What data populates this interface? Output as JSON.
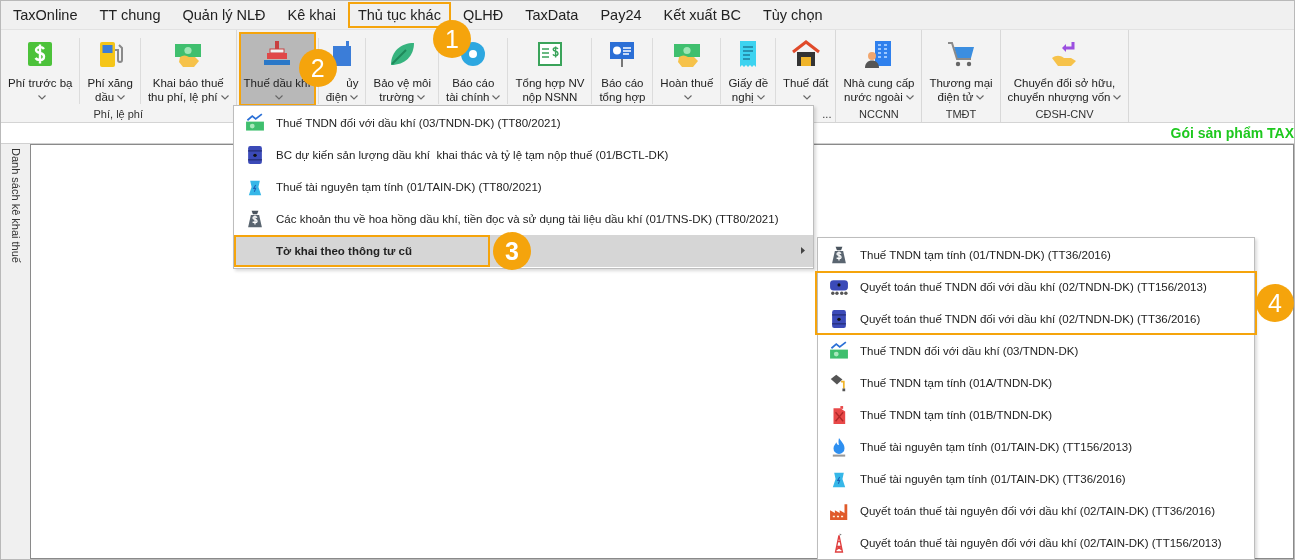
{
  "tabs": [
    {
      "label": "TaxOnline"
    },
    {
      "label": "TT chung"
    },
    {
      "label": "Quản lý NLĐ"
    },
    {
      "label": "Kê khai"
    },
    {
      "label": "Thủ tục khác",
      "callout": "1"
    },
    {
      "label": "QLHĐ"
    },
    {
      "label": "TaxData"
    },
    {
      "label": "Pay24"
    },
    {
      "label": "Kết xuất BC"
    },
    {
      "label": "Tùy chọn"
    }
  ],
  "ribbon": {
    "groups": [
      {
        "label": "Phí, lệ phí",
        "covered": false,
        "buttons": [
          {
            "lines": [
              "Phí trước bạ"
            ],
            "dropdown": true,
            "selected": false,
            "covered": false
          },
          {
            "lines": [
              "Phí xăng",
              "dầu"
            ],
            "dropdown": true,
            "selected": false,
            "covered": false
          },
          {
            "lines": [
              "Khai báo thuế",
              "thu phí, lệ phí"
            ],
            "dropdown": true,
            "selected": false,
            "covered": false
          }
        ]
      },
      {
        "label": "...",
        "covered": true,
        "buttons": [
          {
            "lines": [
              "Thuế dầu khí"
            ],
            "dropdown": true,
            "selected": true,
            "covered": false,
            "callout": "2"
          },
          {
            "lines": [
              "ủy",
              "điện"
            ],
            "dropdown": true,
            "selected": false,
            "covered": true
          },
          {
            "lines": [
              "Bảo vệ môi",
              "trường"
            ],
            "dropdown": true,
            "selected": false,
            "covered": false
          },
          {
            "lines": [
              "Báo cáo",
              "tài chính"
            ],
            "dropdown": true,
            "selected": false,
            "covered": false
          },
          {
            "lines": [
              "Tổng hợp NV",
              "nộp NSNN"
            ],
            "dropdown": false,
            "selected": false,
            "covered": false
          },
          {
            "lines": [
              "Báo cáo",
              "tổng hợp"
            ],
            "dropdown": false,
            "selected": false,
            "covered": false
          },
          {
            "lines": [
              "Hoàn thuế"
            ],
            "dropdown": true,
            "selected": false,
            "covered": false
          },
          {
            "lines": [
              "Giấy đề",
              "nghị"
            ],
            "dropdown": true,
            "selected": false,
            "covered": false
          },
          {
            "lines": [
              "Thuế đất"
            ],
            "dropdown": true,
            "selected": false,
            "covered": false
          }
        ]
      },
      {
        "label": "NCCNN",
        "covered": false,
        "buttons": [
          {
            "lines": [
              "Nhà cung cấp",
              "nước ngoài"
            ],
            "dropdown": true,
            "selected": false,
            "covered": false
          }
        ]
      },
      {
        "label": "TMĐT",
        "covered": false,
        "buttons": [
          {
            "lines": [
              "Thương mại",
              "điện tử"
            ],
            "dropdown": true,
            "selected": false,
            "covered": false
          }
        ]
      },
      {
        "label": "CĐSH-CNV",
        "covered": false,
        "buttons": [
          {
            "lines": [
              "Chuyển đổi sở hữu,",
              "chuyển nhượng vốn"
            ],
            "dropdown": true,
            "selected": false,
            "covered": false
          }
        ]
      }
    ]
  },
  "banner": "Gói sản phẩm TAX",
  "side_panel": {
    "title": "Danh sách kê khai thuế"
  },
  "menu": {
    "items": [
      {
        "label": "Thuế TNDN đối với dầu khí (03/TNDN-DK) (TT80/2021)",
        "selected": false,
        "submenu": false
      },
      {
        "label": "BC dự kiến sản lượng dầu khí  khai thác và tỷ lệ tạm nộp thuế (01/BCTL-DK)",
        "selected": false,
        "submenu": false
      },
      {
        "label": "Thuế tài nguyên tạm tính (01/TAIN-DK) (TT80/2021)",
        "selected": false,
        "submenu": false
      },
      {
        "label": "Các khoản thu về hoa hồng dầu khí, tiền đọc và sử dụng tài liệu dầu khí (01/TNS-DK) (TT80/2021)",
        "selected": false,
        "submenu": false
      },
      {
        "label": "Tờ khai theo thông tư cũ",
        "selected": true,
        "submenu": true,
        "callout": "3"
      }
    ]
  },
  "submenu": {
    "items": [
      {
        "label": "Thuế TNDN tạm tính (01/TNDN-DK) (TT36/2016)"
      },
      {
        "kind": "callout_group",
        "callout": "4",
        "items": [
          {
            "label": "Quyết toán thuế TNDN đối với dầu khí (02/TNDN-DK) (TT156/2013)"
          },
          {
            "label": "Quyết toán thuế TNDN đối với dầu khí (02/TNDN-DK) (TT36/2016)"
          }
        ]
      },
      {
        "label": "Thuế TNDN đối với dầu khí (03/TNDN-DK)"
      },
      {
        "label": "Thuế TNDN tạm tính (01A/TNDN-DK)"
      },
      {
        "label": "Thuế TNDN tạm tính (01B/TNDN-DK)"
      },
      {
        "label": "Thuế tài nguyên tạm tính (01/TAIN-DK) (TT156/2013)"
      },
      {
        "label": "Thuế tài nguyên tạm tính (01/TAIN-DK) (TT36/2016)"
      },
      {
        "label": "Quyết toán thuế tài nguyên đối với dầu khí (02/TAIN-DK) (TT36/2016)"
      },
      {
        "label": "Quyết toán thuế tài nguyên đối với dầu khí (02/TAIN-DK) (TT156/2013)"
      }
    ]
  }
}
